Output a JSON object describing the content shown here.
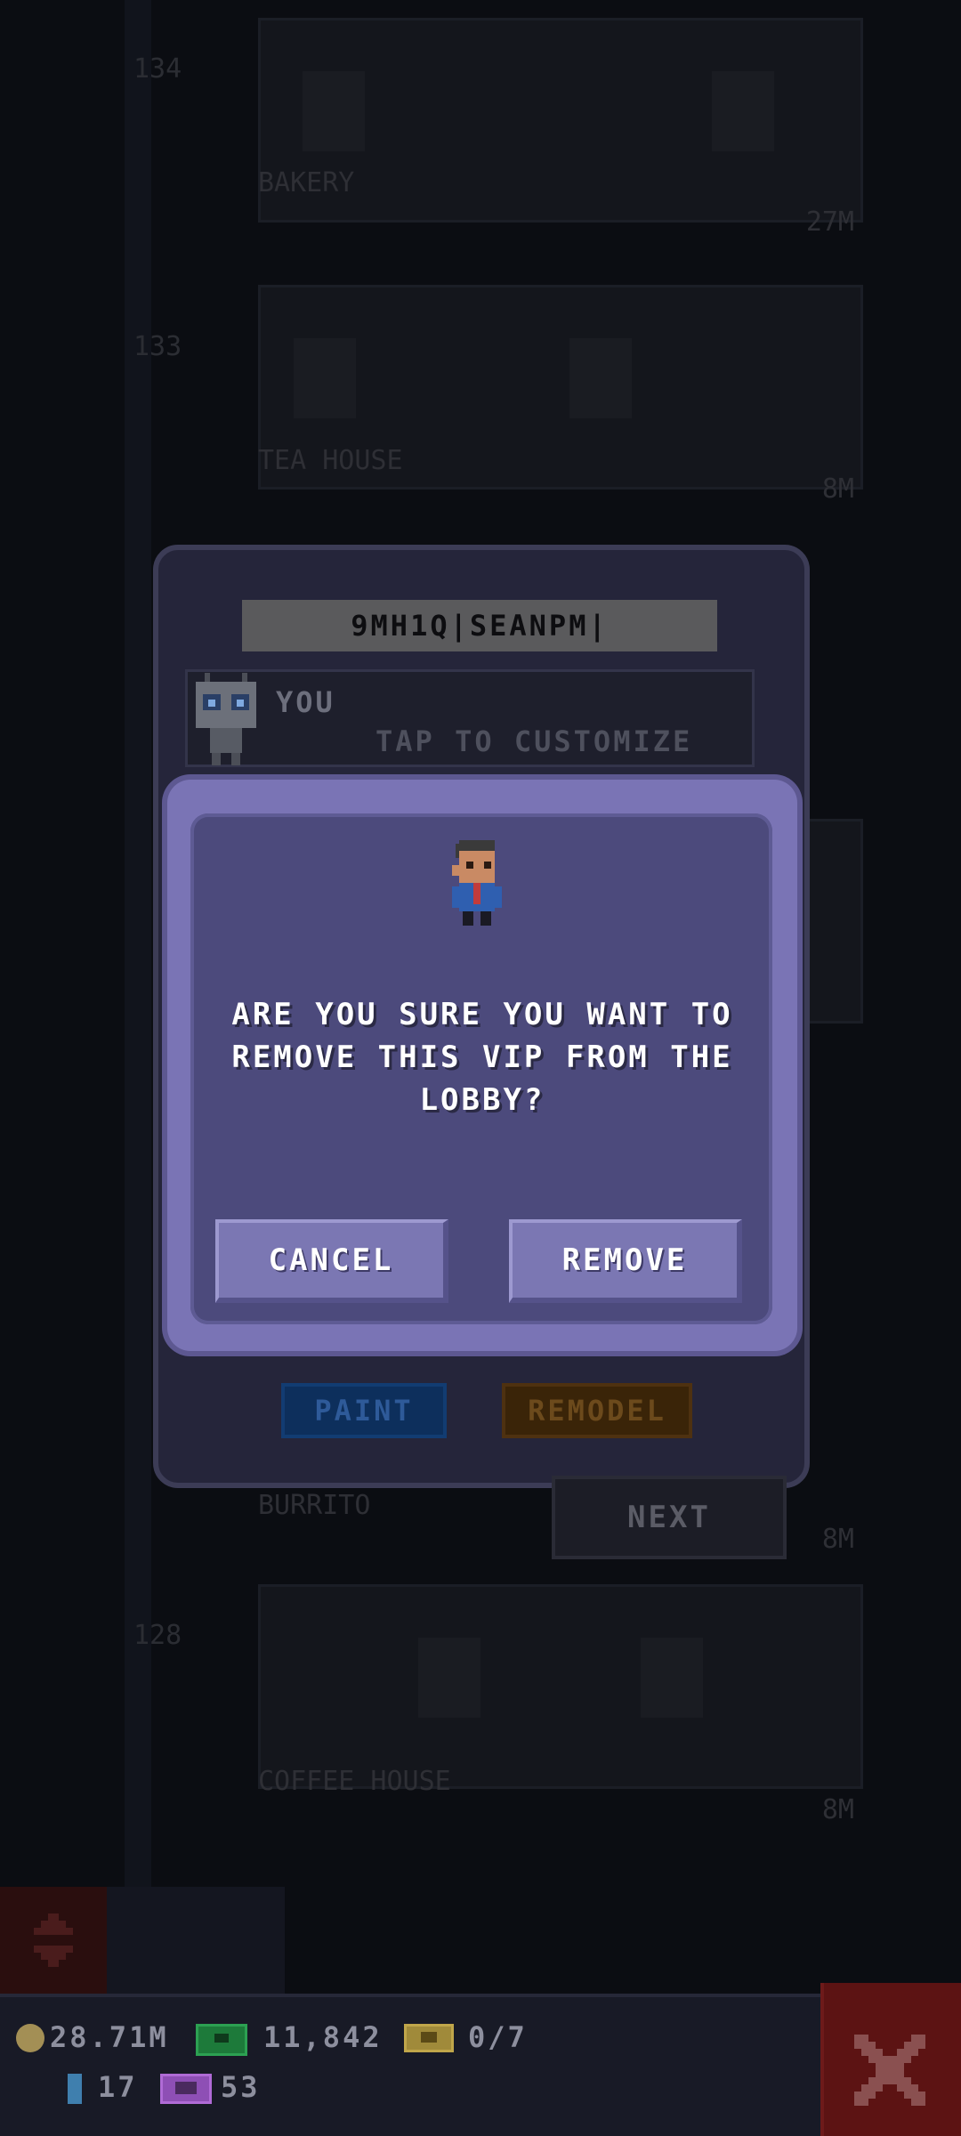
{
  "tower": {
    "floors": [
      {
        "number": "134",
        "name": "",
        "level": ""
      },
      {
        "number": "",
        "name": "BAKERY",
        "level": "27M"
      },
      {
        "number": "133",
        "name": "TEA HOUSE",
        "level": "8M"
      },
      {
        "number": "",
        "name": "BURRITO",
        "level": "8M"
      },
      {
        "number": "128",
        "name": "COFFEE HOUSE",
        "level": "8M"
      }
    ]
  },
  "panel": {
    "name_field": "9MH1Q|SEANPM|",
    "you_label": "YOU",
    "customize_label": "TAP TO CUSTOMIZE",
    "paint_label": "PAINT",
    "remodel_label": "REMODEL",
    "next_label": "NEXT"
  },
  "dialog": {
    "message": "ARE YOU SURE YOU WANT TO REMOVE THIS VIP FROM THE LOBBY?",
    "cancel_label": "CANCEL",
    "remove_label": "REMOVE",
    "sprite_icon": "vip-person-icon"
  },
  "hud": {
    "coins": "28.71M",
    "bux": "11,842",
    "vip_slots": "0/7",
    "keys": "17",
    "tv_tokens": "53",
    "icons": [
      "coin-icon",
      "bux-icon",
      "vip-ticket-icon",
      "key-icon",
      "tv-icon",
      "close-icon"
    ]
  },
  "colors": {
    "dialog_frame": "#7a74b5",
    "dialog_fill": "#4c4a7c",
    "button_fill": "#7b77b3",
    "close_red": "#5c1313"
  }
}
